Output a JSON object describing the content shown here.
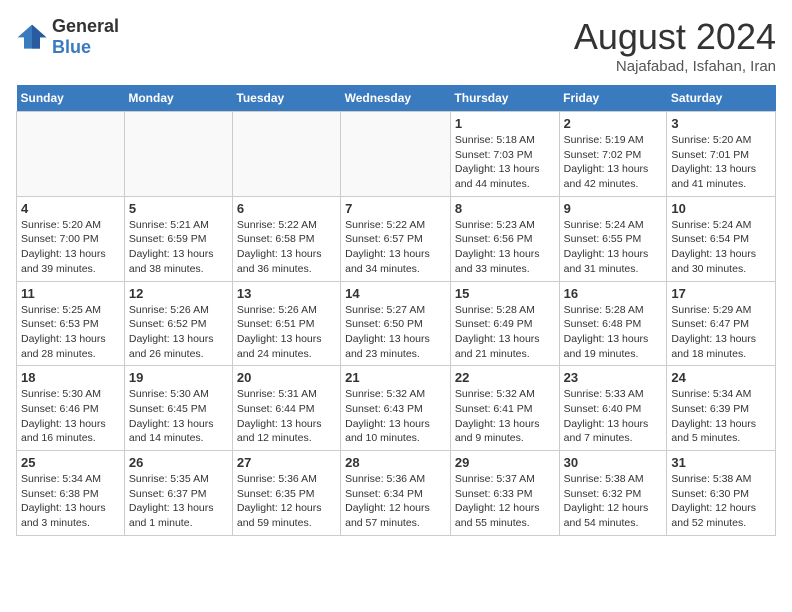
{
  "header": {
    "logo": {
      "text_general": "General",
      "text_blue": "Blue"
    },
    "title": "August 2024",
    "location": "Najafabad, Isfahan, Iran"
  },
  "days_of_week": [
    "Sunday",
    "Monday",
    "Tuesday",
    "Wednesday",
    "Thursday",
    "Friday",
    "Saturday"
  ],
  "weeks": [
    [
      {
        "day": "",
        "info": ""
      },
      {
        "day": "",
        "info": ""
      },
      {
        "day": "",
        "info": ""
      },
      {
        "day": "",
        "info": ""
      },
      {
        "day": "1",
        "info": "Sunrise: 5:18 AM\nSunset: 7:03 PM\nDaylight: 13 hours\nand 44 minutes."
      },
      {
        "day": "2",
        "info": "Sunrise: 5:19 AM\nSunset: 7:02 PM\nDaylight: 13 hours\nand 42 minutes."
      },
      {
        "day": "3",
        "info": "Sunrise: 5:20 AM\nSunset: 7:01 PM\nDaylight: 13 hours\nand 41 minutes."
      }
    ],
    [
      {
        "day": "4",
        "info": "Sunrise: 5:20 AM\nSunset: 7:00 PM\nDaylight: 13 hours\nand 39 minutes."
      },
      {
        "day": "5",
        "info": "Sunrise: 5:21 AM\nSunset: 6:59 PM\nDaylight: 13 hours\nand 38 minutes."
      },
      {
        "day": "6",
        "info": "Sunrise: 5:22 AM\nSunset: 6:58 PM\nDaylight: 13 hours\nand 36 minutes."
      },
      {
        "day": "7",
        "info": "Sunrise: 5:22 AM\nSunset: 6:57 PM\nDaylight: 13 hours\nand 34 minutes."
      },
      {
        "day": "8",
        "info": "Sunrise: 5:23 AM\nSunset: 6:56 PM\nDaylight: 13 hours\nand 33 minutes."
      },
      {
        "day": "9",
        "info": "Sunrise: 5:24 AM\nSunset: 6:55 PM\nDaylight: 13 hours\nand 31 minutes."
      },
      {
        "day": "10",
        "info": "Sunrise: 5:24 AM\nSunset: 6:54 PM\nDaylight: 13 hours\nand 30 minutes."
      }
    ],
    [
      {
        "day": "11",
        "info": "Sunrise: 5:25 AM\nSunset: 6:53 PM\nDaylight: 13 hours\nand 28 minutes."
      },
      {
        "day": "12",
        "info": "Sunrise: 5:26 AM\nSunset: 6:52 PM\nDaylight: 13 hours\nand 26 minutes."
      },
      {
        "day": "13",
        "info": "Sunrise: 5:26 AM\nSunset: 6:51 PM\nDaylight: 13 hours\nand 24 minutes."
      },
      {
        "day": "14",
        "info": "Sunrise: 5:27 AM\nSunset: 6:50 PM\nDaylight: 13 hours\nand 23 minutes."
      },
      {
        "day": "15",
        "info": "Sunrise: 5:28 AM\nSunset: 6:49 PM\nDaylight: 13 hours\nand 21 minutes."
      },
      {
        "day": "16",
        "info": "Sunrise: 5:28 AM\nSunset: 6:48 PM\nDaylight: 13 hours\nand 19 minutes."
      },
      {
        "day": "17",
        "info": "Sunrise: 5:29 AM\nSunset: 6:47 PM\nDaylight: 13 hours\nand 18 minutes."
      }
    ],
    [
      {
        "day": "18",
        "info": "Sunrise: 5:30 AM\nSunset: 6:46 PM\nDaylight: 13 hours\nand 16 minutes."
      },
      {
        "day": "19",
        "info": "Sunrise: 5:30 AM\nSunset: 6:45 PM\nDaylight: 13 hours\nand 14 minutes."
      },
      {
        "day": "20",
        "info": "Sunrise: 5:31 AM\nSunset: 6:44 PM\nDaylight: 13 hours\nand 12 minutes."
      },
      {
        "day": "21",
        "info": "Sunrise: 5:32 AM\nSunset: 6:43 PM\nDaylight: 13 hours\nand 10 minutes."
      },
      {
        "day": "22",
        "info": "Sunrise: 5:32 AM\nSunset: 6:41 PM\nDaylight: 13 hours\nand 9 minutes."
      },
      {
        "day": "23",
        "info": "Sunrise: 5:33 AM\nSunset: 6:40 PM\nDaylight: 13 hours\nand 7 minutes."
      },
      {
        "day": "24",
        "info": "Sunrise: 5:34 AM\nSunset: 6:39 PM\nDaylight: 13 hours\nand 5 minutes."
      }
    ],
    [
      {
        "day": "25",
        "info": "Sunrise: 5:34 AM\nSunset: 6:38 PM\nDaylight: 13 hours\nand 3 minutes."
      },
      {
        "day": "26",
        "info": "Sunrise: 5:35 AM\nSunset: 6:37 PM\nDaylight: 13 hours\nand 1 minute."
      },
      {
        "day": "27",
        "info": "Sunrise: 5:36 AM\nSunset: 6:35 PM\nDaylight: 12 hours\nand 59 minutes."
      },
      {
        "day": "28",
        "info": "Sunrise: 5:36 AM\nSunset: 6:34 PM\nDaylight: 12 hours\nand 57 minutes."
      },
      {
        "day": "29",
        "info": "Sunrise: 5:37 AM\nSunset: 6:33 PM\nDaylight: 12 hours\nand 55 minutes."
      },
      {
        "day": "30",
        "info": "Sunrise: 5:38 AM\nSunset: 6:32 PM\nDaylight: 12 hours\nand 54 minutes."
      },
      {
        "day": "31",
        "info": "Sunrise: 5:38 AM\nSunset: 6:30 PM\nDaylight: 12 hours\nand 52 minutes."
      }
    ]
  ]
}
